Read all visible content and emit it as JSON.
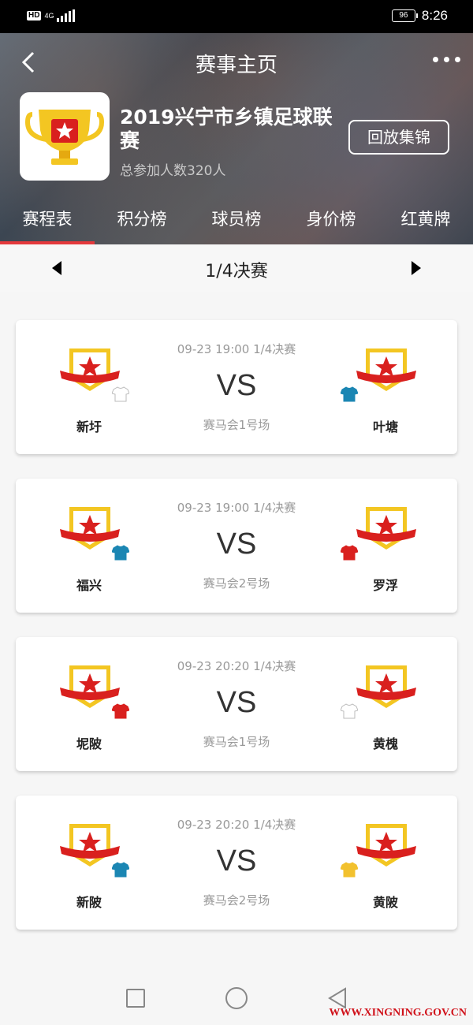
{
  "status_bar": {
    "hd": "HD",
    "network": "4G",
    "battery": "96",
    "time": "8:26"
  },
  "header": {
    "page_title": "赛事主页",
    "league_title": "2019兴宁市乡镇足球联赛",
    "participants": "总参加人数320人",
    "replay_button": "回放集锦"
  },
  "tabs": [
    {
      "label": "赛程表",
      "active": true
    },
    {
      "label": "积分榜",
      "active": false
    },
    {
      "label": "球员榜",
      "active": false
    },
    {
      "label": "身价榜",
      "active": false
    },
    {
      "label": "红黄牌",
      "active": false
    }
  ],
  "round": {
    "label": "1/4决赛"
  },
  "matches": [
    {
      "time": "09-23 19:00 1/4决赛",
      "vs": "VS",
      "venue": "赛马会1号场",
      "home": {
        "name": "新圩",
        "jersey_color": "#ffffff"
      },
      "away": {
        "name": "叶塘",
        "jersey_color": "#1b86b3"
      }
    },
    {
      "time": "09-23 19:00 1/4决赛",
      "vs": "VS",
      "venue": "赛马会2号场",
      "home": {
        "name": "福兴",
        "jersey_color": "#1b86b3"
      },
      "away": {
        "name": "罗浮",
        "jersey_color": "#d9201e"
      }
    },
    {
      "time": "09-23 20:20 1/4决赛",
      "vs": "VS",
      "venue": "赛马会1号场",
      "home": {
        "name": "坭陂",
        "jersey_color": "#d9201e"
      },
      "away": {
        "name": "黄槐",
        "jersey_color": "#ffffff"
      }
    },
    {
      "time": "09-23 20:20 1/4决赛",
      "vs": "VS",
      "venue": "赛马会2号场",
      "home": {
        "name": "新陂",
        "jersey_color": "#1b86b3"
      },
      "away": {
        "name": "黄陂",
        "jersey_color": "#f2c12e"
      }
    }
  ],
  "watermark": "WWW.XINGNING.GOV.CN",
  "colors": {
    "accent": "#e4393c",
    "badge_gold": "#f3c622",
    "badge_red": "#d9201e"
  }
}
